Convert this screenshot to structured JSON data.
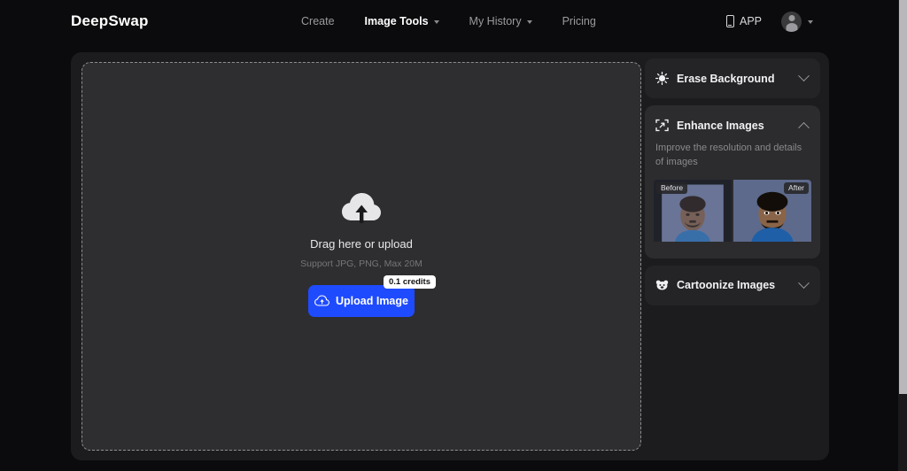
{
  "brand": {
    "logo": "DeepSwap"
  },
  "nav": {
    "items": [
      {
        "label": "Create",
        "has_caret": false,
        "active": false
      },
      {
        "label": "Image Tools",
        "has_caret": true,
        "active": true
      },
      {
        "label": "My History",
        "has_caret": true,
        "active": false
      },
      {
        "label": "Pricing",
        "has_caret": false,
        "active": false
      }
    ]
  },
  "header_right": {
    "app_label": "APP",
    "app_icon": "phone-icon",
    "avatar_icon": "user-avatar-icon",
    "avatar_caret": "chevron-down-icon"
  },
  "dropzone": {
    "icon": "cloud-upload-icon",
    "title": "Drag here or upload",
    "support_text": "Support JPG, PNG, Max 20M",
    "button_label": "Upload Image",
    "button_icon": "cloud-upload-small-icon",
    "credits_badge": "0.1 credits"
  },
  "panels": [
    {
      "id": "erase-background",
      "icon": "sparkle-sun-icon",
      "title": "Erase Background",
      "expanded": false,
      "chevron": "chevron-down-icon"
    },
    {
      "id": "enhance-images",
      "icon": "enhance-frame-icon",
      "title": "Enhance Images",
      "expanded": true,
      "chevron": "chevron-up-icon",
      "description": "Improve the resolution and details of images",
      "compare": {
        "before_label": "Before",
        "after_label": "After"
      }
    },
    {
      "id": "cartoonize-images",
      "icon": "bear-face-icon",
      "title": "Cartoonize Images",
      "expanded": false,
      "chevron": "chevron-down-icon"
    }
  ],
  "colors": {
    "page_background": "#0b0b0d",
    "card_background": "#1c1c1e",
    "dropzone_background": "#2e2e30",
    "panel_background": "#242426",
    "panel_expanded_background": "#2c2c2e",
    "accent_blue": "#1f4bff",
    "text_primary": "#f2f2f4",
    "text_muted": "#8a8a8e",
    "scrollbar_thumb": "#b8b8ba"
  }
}
